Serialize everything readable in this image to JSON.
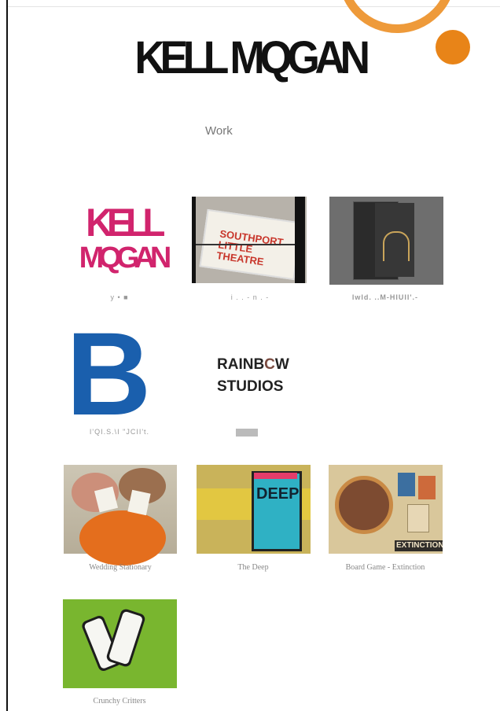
{
  "site": {
    "title": "KELL MQGAN",
    "nav_work": "Work"
  },
  "tiles": [
    {
      "logo_line1": "KELL",
      "logo_line2": "MQGAN",
      "caption": "y •                    ■"
    },
    {
      "sign_text": "SOUTHPORT LITTLE THEATRE",
      "caption": "i  .  .  -      n   .  -"
    },
    {
      "caption": "lwld. ..M-HIUII'.-"
    },
    {
      "letter": "B",
      "caption": "I'QI.S.\\I  \"JCII't."
    },
    {
      "line1_a": "RAINB",
      "line1_o": "C",
      "line1_b": "W",
      "line2": "STUDIOS"
    },
    {
      "caption": "Wedding Stationary"
    },
    {
      "poster_text": "DEEP",
      "caption": "The Deep"
    },
    {
      "banner_text": "EXTINCTION",
      "caption": "Board Game - Extinction"
    },
    {
      "caption": "Crunchy Critters"
    }
  ],
  "colors": {
    "accent_orange": "#e88418",
    "logo_pink": "#d1246d",
    "b_blue": "#1a5fad"
  }
}
